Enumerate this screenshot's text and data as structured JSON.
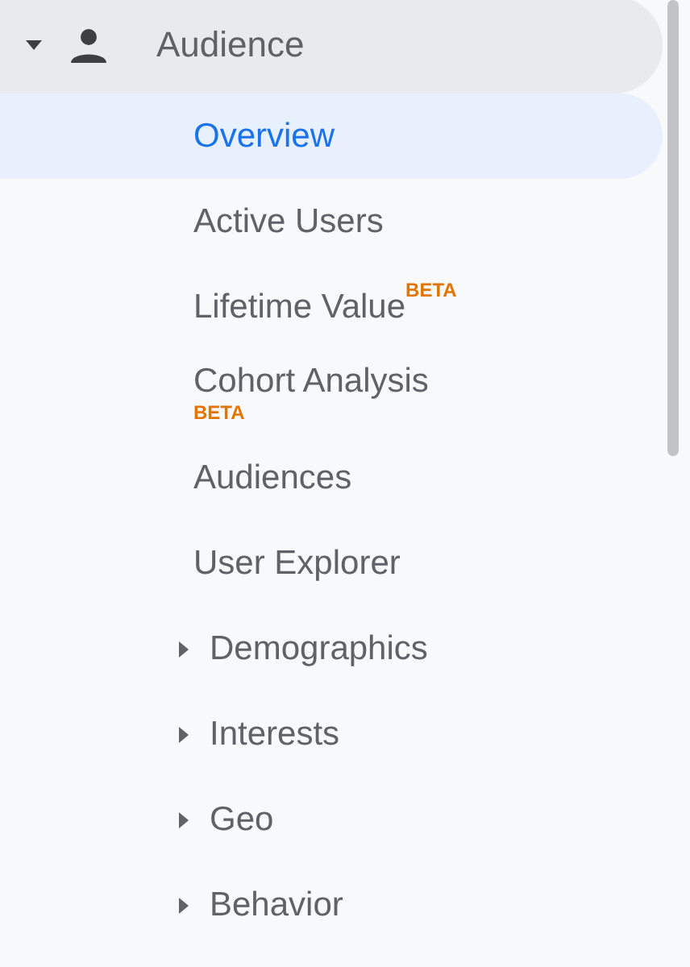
{
  "section": {
    "label": "Audience",
    "expanded": true
  },
  "items": [
    {
      "kind": "link",
      "label": "Overview",
      "selected": true
    },
    {
      "kind": "link",
      "label": "Active Users",
      "selected": false
    },
    {
      "kind": "link",
      "label": "Lifetime Value",
      "selected": false,
      "badge": {
        "text": "BETA",
        "raised": true
      }
    },
    {
      "kind": "link",
      "label": "Cohort Analysis",
      "selected": false,
      "badge": {
        "text": "BETA",
        "raised": false
      }
    },
    {
      "kind": "link",
      "label": "Audiences",
      "selected": false
    },
    {
      "kind": "link",
      "label": "User Explorer",
      "selected": false
    },
    {
      "kind": "group",
      "label": "Demographics",
      "expanded": false
    },
    {
      "kind": "group",
      "label": "Interests",
      "expanded": false
    },
    {
      "kind": "group",
      "label": "Geo",
      "expanded": false
    },
    {
      "kind": "group",
      "label": "Behavior",
      "expanded": false
    }
  ]
}
